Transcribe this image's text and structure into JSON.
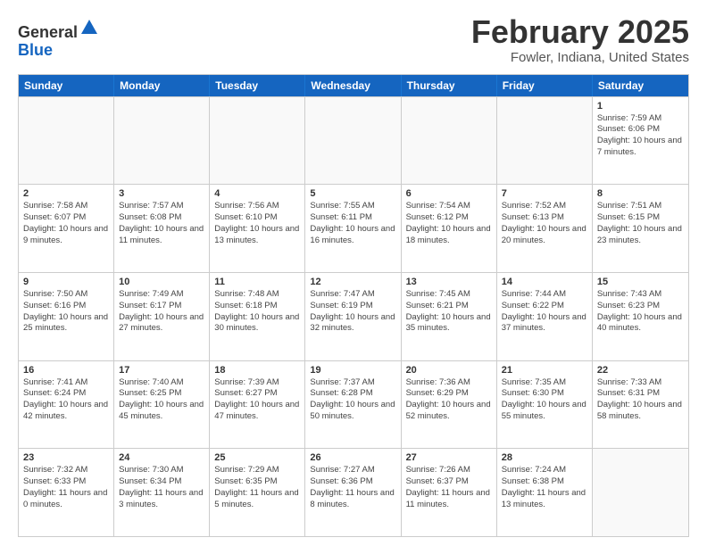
{
  "header": {
    "logo_general": "General",
    "logo_blue": "Blue",
    "month_year": "February 2025",
    "location": "Fowler, Indiana, United States"
  },
  "calendar": {
    "days_of_week": [
      "Sunday",
      "Monday",
      "Tuesday",
      "Wednesday",
      "Thursday",
      "Friday",
      "Saturday"
    ],
    "rows": [
      [
        {
          "day": "",
          "text": ""
        },
        {
          "day": "",
          "text": ""
        },
        {
          "day": "",
          "text": ""
        },
        {
          "day": "",
          "text": ""
        },
        {
          "day": "",
          "text": ""
        },
        {
          "day": "",
          "text": ""
        },
        {
          "day": "1",
          "text": "Sunrise: 7:59 AM\nSunset: 6:06 PM\nDaylight: 10 hours and 7 minutes."
        }
      ],
      [
        {
          "day": "2",
          "text": "Sunrise: 7:58 AM\nSunset: 6:07 PM\nDaylight: 10 hours and 9 minutes."
        },
        {
          "day": "3",
          "text": "Sunrise: 7:57 AM\nSunset: 6:08 PM\nDaylight: 10 hours and 11 minutes."
        },
        {
          "day": "4",
          "text": "Sunrise: 7:56 AM\nSunset: 6:10 PM\nDaylight: 10 hours and 13 minutes."
        },
        {
          "day": "5",
          "text": "Sunrise: 7:55 AM\nSunset: 6:11 PM\nDaylight: 10 hours and 16 minutes."
        },
        {
          "day": "6",
          "text": "Sunrise: 7:54 AM\nSunset: 6:12 PM\nDaylight: 10 hours and 18 minutes."
        },
        {
          "day": "7",
          "text": "Sunrise: 7:52 AM\nSunset: 6:13 PM\nDaylight: 10 hours and 20 minutes."
        },
        {
          "day": "8",
          "text": "Sunrise: 7:51 AM\nSunset: 6:15 PM\nDaylight: 10 hours and 23 minutes."
        }
      ],
      [
        {
          "day": "9",
          "text": "Sunrise: 7:50 AM\nSunset: 6:16 PM\nDaylight: 10 hours and 25 minutes."
        },
        {
          "day": "10",
          "text": "Sunrise: 7:49 AM\nSunset: 6:17 PM\nDaylight: 10 hours and 27 minutes."
        },
        {
          "day": "11",
          "text": "Sunrise: 7:48 AM\nSunset: 6:18 PM\nDaylight: 10 hours and 30 minutes."
        },
        {
          "day": "12",
          "text": "Sunrise: 7:47 AM\nSunset: 6:19 PM\nDaylight: 10 hours and 32 minutes."
        },
        {
          "day": "13",
          "text": "Sunrise: 7:45 AM\nSunset: 6:21 PM\nDaylight: 10 hours and 35 minutes."
        },
        {
          "day": "14",
          "text": "Sunrise: 7:44 AM\nSunset: 6:22 PM\nDaylight: 10 hours and 37 minutes."
        },
        {
          "day": "15",
          "text": "Sunrise: 7:43 AM\nSunset: 6:23 PM\nDaylight: 10 hours and 40 minutes."
        }
      ],
      [
        {
          "day": "16",
          "text": "Sunrise: 7:41 AM\nSunset: 6:24 PM\nDaylight: 10 hours and 42 minutes."
        },
        {
          "day": "17",
          "text": "Sunrise: 7:40 AM\nSunset: 6:25 PM\nDaylight: 10 hours and 45 minutes."
        },
        {
          "day": "18",
          "text": "Sunrise: 7:39 AM\nSunset: 6:27 PM\nDaylight: 10 hours and 47 minutes."
        },
        {
          "day": "19",
          "text": "Sunrise: 7:37 AM\nSunset: 6:28 PM\nDaylight: 10 hours and 50 minutes."
        },
        {
          "day": "20",
          "text": "Sunrise: 7:36 AM\nSunset: 6:29 PM\nDaylight: 10 hours and 52 minutes."
        },
        {
          "day": "21",
          "text": "Sunrise: 7:35 AM\nSunset: 6:30 PM\nDaylight: 10 hours and 55 minutes."
        },
        {
          "day": "22",
          "text": "Sunrise: 7:33 AM\nSunset: 6:31 PM\nDaylight: 10 hours and 58 minutes."
        }
      ],
      [
        {
          "day": "23",
          "text": "Sunrise: 7:32 AM\nSunset: 6:33 PM\nDaylight: 11 hours and 0 minutes."
        },
        {
          "day": "24",
          "text": "Sunrise: 7:30 AM\nSunset: 6:34 PM\nDaylight: 11 hours and 3 minutes."
        },
        {
          "day": "25",
          "text": "Sunrise: 7:29 AM\nSunset: 6:35 PM\nDaylight: 11 hours and 5 minutes."
        },
        {
          "day": "26",
          "text": "Sunrise: 7:27 AM\nSunset: 6:36 PM\nDaylight: 11 hours and 8 minutes."
        },
        {
          "day": "27",
          "text": "Sunrise: 7:26 AM\nSunset: 6:37 PM\nDaylight: 11 hours and 11 minutes."
        },
        {
          "day": "28",
          "text": "Sunrise: 7:24 AM\nSunset: 6:38 PM\nDaylight: 11 hours and 13 minutes."
        },
        {
          "day": "",
          "text": ""
        }
      ]
    ]
  }
}
